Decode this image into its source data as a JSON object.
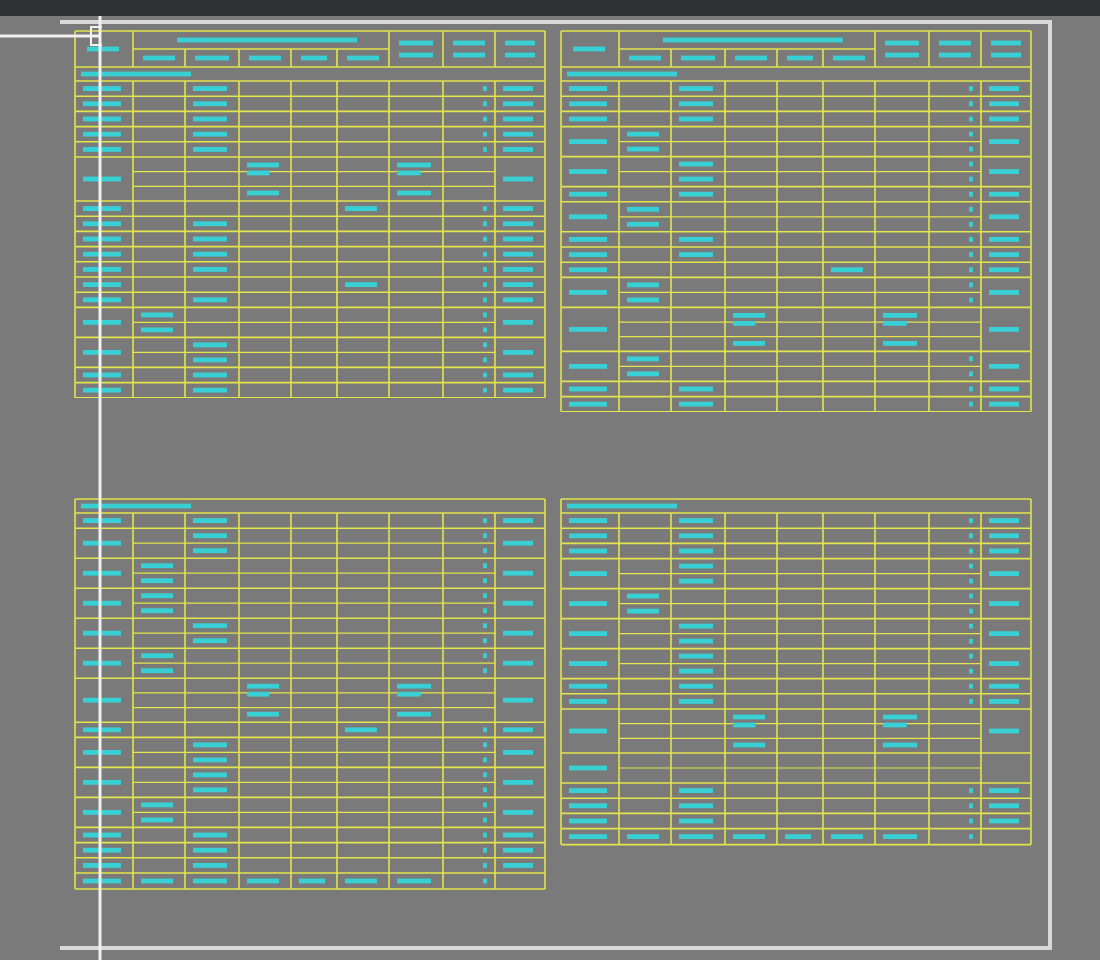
{
  "viewport": {
    "kind": "model_space"
  },
  "tables": [
    {
      "rows": [
        {
          "kind": "header"
        },
        {
          "kind": "section"
        },
        {
          "kind": "code"
        },
        {
          "kind": "code"
        },
        {
          "kind": "code"
        },
        {
          "kind": "code"
        },
        {
          "kind": "code"
        },
        {
          "kind": "group"
        },
        {
          "kind": "note"
        },
        {
          "kind": "code"
        },
        {
          "kind": "code"
        },
        {
          "kind": "code"
        },
        {
          "kind": "code"
        },
        {
          "kind": "note"
        },
        {
          "kind": "code"
        },
        {
          "kind": "spec_pair"
        },
        {
          "kind": "code_pair"
        },
        {
          "kind": "code"
        },
        {
          "kind": "code"
        }
      ]
    },
    {
      "rows": [
        {
          "kind": "header"
        },
        {
          "kind": "section"
        },
        {
          "kind": "code"
        },
        {
          "kind": "code"
        },
        {
          "kind": "code"
        },
        {
          "kind": "spec_pair"
        },
        {
          "kind": "code_pair"
        },
        {
          "kind": "code"
        },
        {
          "kind": "spec_pair"
        },
        {
          "kind": "code"
        },
        {
          "kind": "code"
        },
        {
          "kind": "note"
        },
        {
          "kind": "spec_pair"
        },
        {
          "kind": "group"
        },
        {
          "kind": "spec_pair"
        },
        {
          "kind": "code"
        },
        {
          "kind": "code"
        }
      ]
    },
    {
      "rows": [
        {
          "kind": "section"
        },
        {
          "kind": "code"
        },
        {
          "kind": "code_pair"
        },
        {
          "kind": "spec_pair"
        },
        {
          "kind": "spec_pair"
        },
        {
          "kind": "code_pair"
        },
        {
          "kind": "spec_pair"
        },
        {
          "kind": "group"
        },
        {
          "kind": "note"
        },
        {
          "kind": "code_pair"
        },
        {
          "kind": "code_pair"
        },
        {
          "kind": "spec_pair"
        },
        {
          "kind": "code"
        },
        {
          "kind": "code"
        },
        {
          "kind": "code"
        },
        {
          "kind": "total"
        }
      ]
    },
    {
      "rows": [
        {
          "kind": "section"
        },
        {
          "kind": "code"
        },
        {
          "kind": "code"
        },
        {
          "kind": "code"
        },
        {
          "kind": "code_pair"
        },
        {
          "kind": "spec_pair"
        },
        {
          "kind": "code_pair"
        },
        {
          "kind": "code_pair"
        },
        {
          "kind": "code"
        },
        {
          "kind": "code"
        },
        {
          "kind": "group"
        },
        {
          "kind": "blank_pair"
        },
        {
          "kind": "code"
        },
        {
          "kind": "code"
        },
        {
          "kind": "code"
        },
        {
          "kind": "total"
        }
      ]
    }
  ]
}
